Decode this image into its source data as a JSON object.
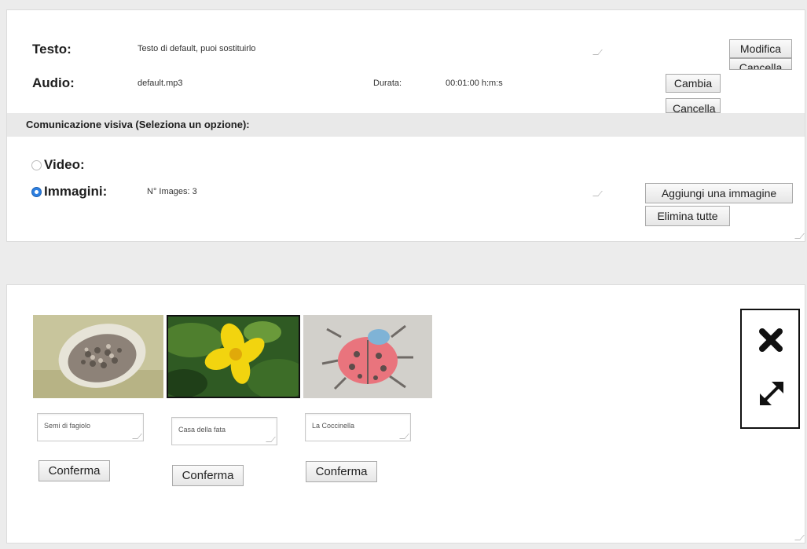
{
  "content": {
    "testo_label": "Testo:",
    "testo_value": "Testo di default, puoi sostituirlo",
    "audio_label": "Audio:",
    "audio_value": "default.mp3",
    "durata_label": "Durata:",
    "durata_value": "00:01:00 h:m:s",
    "modifica_label": "Modifica",
    "cancella_label": "Cancella",
    "cambia_label": "Cambia",
    "cancella_audio_label": "Cancella"
  },
  "visual": {
    "section_title": "Comunicazione visiva (Seleziona un opzione):",
    "video_label": "Video:",
    "immagini_label": "Immagini:",
    "images_count": "N° Images: 3",
    "aggiungi_label": "Aggiungi una immagine",
    "elimina_label": "Elimina tutte",
    "selected_option": "immagini"
  },
  "gallery": {
    "images": [
      {
        "caption": "Semi di fagiolo",
        "confirm_label": "Conferma",
        "icon": "bean-seeds-photo"
      },
      {
        "caption": "Casa della fata",
        "confirm_label": "Conferma",
        "icon": "yellow-flower-photo"
      },
      {
        "caption": "La Coccinella",
        "confirm_label": "Conferma",
        "icon": "ladybug-photo"
      }
    ],
    "selected_index": 1,
    "close_icon": "close-icon",
    "expand_icon": "expand-icon"
  },
  "colors": {
    "accent": "#2d7fe0",
    "section_bar": "#e9e9e9",
    "page_bg": "#ececec"
  }
}
